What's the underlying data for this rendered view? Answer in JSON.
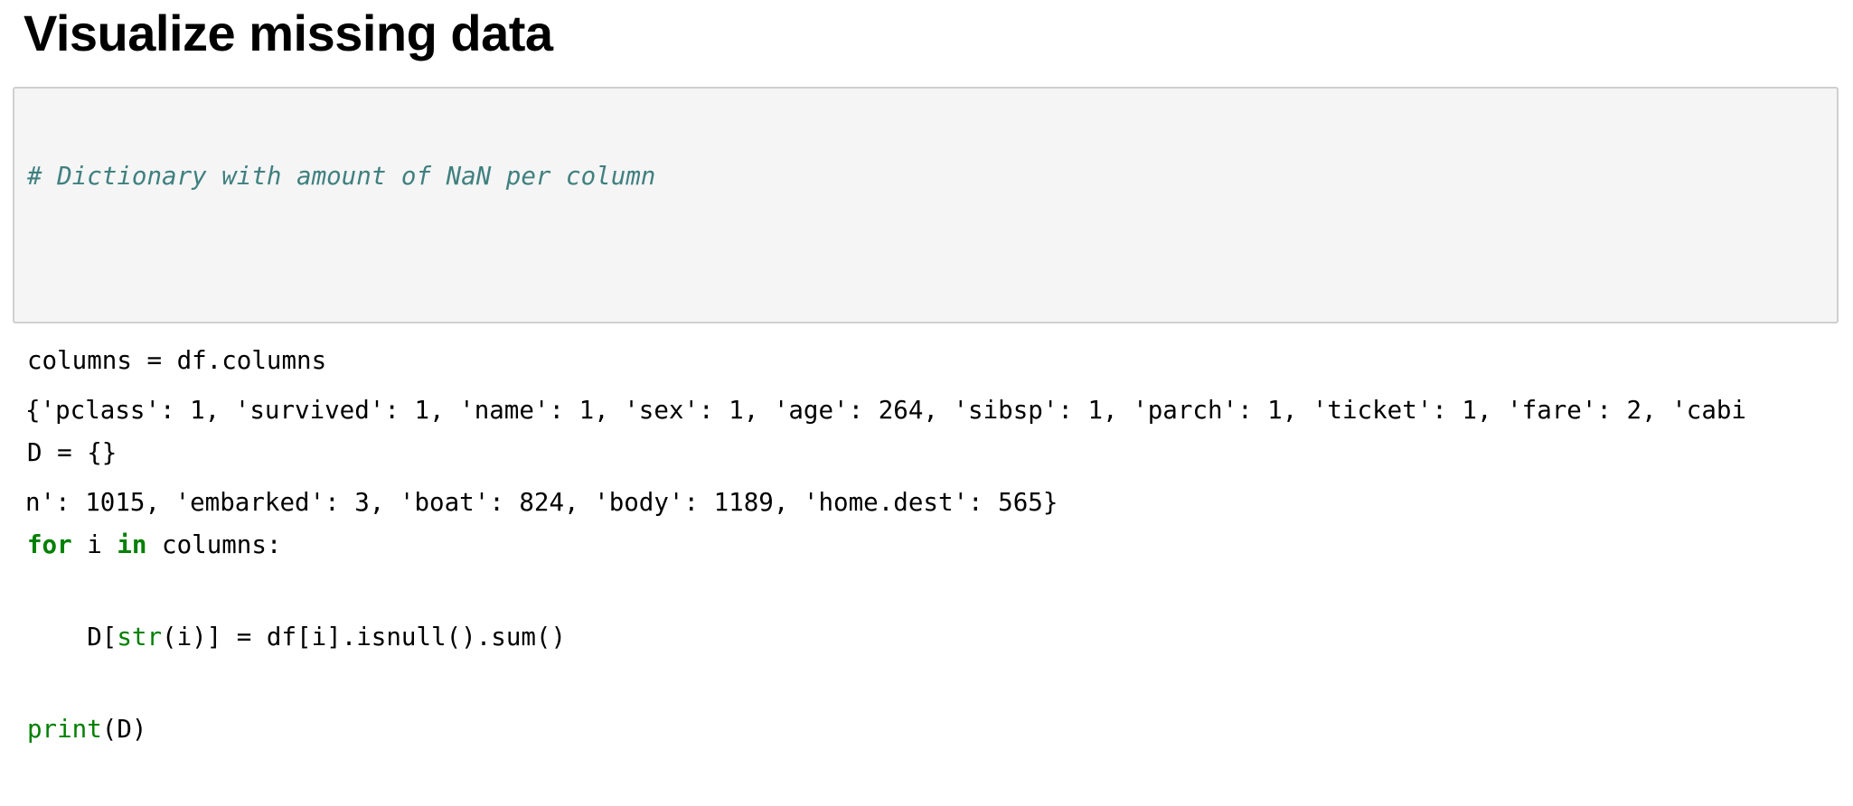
{
  "heading": "Visualize missing data",
  "code": {
    "comment": "# Dictionary with amount of NaN per column",
    "line_columns": "columns = df.columns",
    "line_dict": "D = {}",
    "for_keyword": "for",
    "for_var": " i ",
    "in_keyword": "in",
    "for_rest": " columns:",
    "loop_indent_prefix": "    D[",
    "str_builtin": "str",
    "loop_rest": "(i)] = df[i].isnull().sum()",
    "print_builtin": "print",
    "print_rest": "(D)"
  },
  "output": {
    "line1": "{'pclass': 1, 'survived': 1, 'name': 1, 'sex': 1, 'age': 264, 'sibsp': 1, 'parch': 1, 'ticket': 1, 'fare': 2, 'cabi",
    "line2": "n': 1015, 'embarked': 3, 'boat': 824, 'body': 1189, 'home.dest': 565}"
  }
}
